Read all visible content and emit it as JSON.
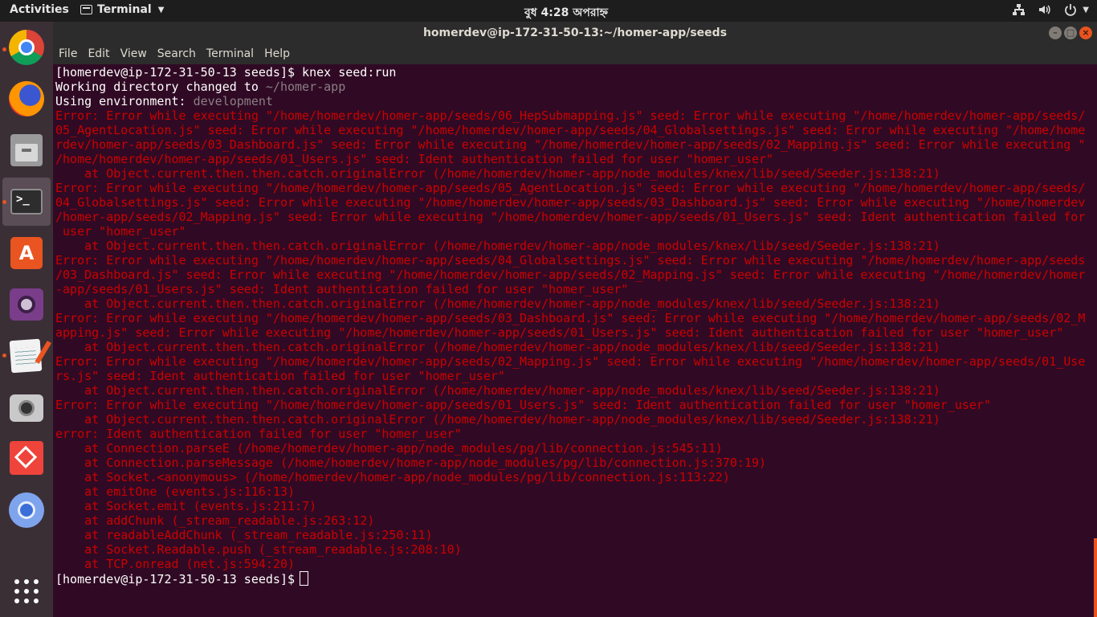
{
  "topbar": {
    "activities": "Activities",
    "app_name": "Terminal",
    "clock": "বুধ  4:28 অপরাহ্ন"
  },
  "window": {
    "title": "homerdev@ip-172-31-50-13:~/homer-app/seeds",
    "buttons": {
      "minimize": "–",
      "maximize": "□",
      "close": "×"
    }
  },
  "menu": [
    "File",
    "Edit",
    "View",
    "Search",
    "Terminal",
    "Help"
  ],
  "dock": [
    {
      "name": "chrome-icon",
      "running": true
    },
    {
      "name": "firefox-icon",
      "running": false
    },
    {
      "name": "files-icon",
      "running": false
    },
    {
      "name": "terminal-icon",
      "running": true,
      "active": true
    },
    {
      "name": "software-center-icon",
      "running": false
    },
    {
      "name": "cheese-webcam-icon",
      "running": false
    },
    {
      "name": "text-editor-icon",
      "running": true
    },
    {
      "name": "screenshot-camera-icon",
      "running": false
    },
    {
      "name": "anydesk-icon",
      "running": false
    },
    {
      "name": "chromium-icon",
      "running": false
    }
  ],
  "terminal": {
    "prompt": "[homerdev@ip-172-31-50-13 seeds]$",
    "command": "knex seed:run",
    "lines": [
      {
        "t": "Working directory changed to ",
        "v": "~/homer-app"
      },
      {
        "t": "Using environment: ",
        "v": "development"
      },
      {
        "red": "Error: Error while executing \"/home/homerdev/homer-app/seeds/06_HepSubmapping.js\" seed: Error while executing \"/home/homerdev/homer-app/seeds/"
      },
      {
        "red": "05_AgentLocation.js\" seed: Error while executing \"/home/homerdev/homer-app/seeds/04_Globalsettings.js\" seed: Error while executing \"/home/home"
      },
      {
        "red": "rdev/homer-app/seeds/03_Dashboard.js\" seed: Error while executing \"/home/homerdev/homer-app/seeds/02_Mapping.js\" seed: Error while executing \""
      },
      {
        "red": "/home/homerdev/homer-app/seeds/01_Users.js\" seed: Ident authentication failed for user \"homer_user\""
      },
      {
        "red": "    at Object.current.then.then.catch.originalError (/home/homerdev/homer-app/node_modules/knex/lib/seed/Seeder.js:138:21)"
      },
      {
        "red": "Error: Error while executing \"/home/homerdev/homer-app/seeds/05_AgentLocation.js\" seed: Error while executing \"/home/homerdev/homer-app/seeds/"
      },
      {
        "red": "04_Globalsettings.js\" seed: Error while executing \"/home/homerdev/homer-app/seeds/03_Dashboard.js\" seed: Error while executing \"/home/homerdev"
      },
      {
        "red": "/homer-app/seeds/02_Mapping.js\" seed: Error while executing \"/home/homerdev/homer-app/seeds/01_Users.js\" seed: Ident authentication failed for"
      },
      {
        "red": " user \"homer_user\""
      },
      {
        "red": "    at Object.current.then.then.catch.originalError (/home/homerdev/homer-app/node_modules/knex/lib/seed/Seeder.js:138:21)"
      },
      {
        "red": "Error: Error while executing \"/home/homerdev/homer-app/seeds/04_Globalsettings.js\" seed: Error while executing \"/home/homerdev/homer-app/seeds"
      },
      {
        "red": "/03_Dashboard.js\" seed: Error while executing \"/home/homerdev/homer-app/seeds/02_Mapping.js\" seed: Error while executing \"/home/homerdev/homer"
      },
      {
        "red": "-app/seeds/01_Users.js\" seed: Ident authentication failed for user \"homer_user\""
      },
      {
        "red": "    at Object.current.then.then.catch.originalError (/home/homerdev/homer-app/node_modules/knex/lib/seed/Seeder.js:138:21)"
      },
      {
        "red": "Error: Error while executing \"/home/homerdev/homer-app/seeds/03_Dashboard.js\" seed: Error while executing \"/home/homerdev/homer-app/seeds/02_M"
      },
      {
        "red": "apping.js\" seed: Error while executing \"/home/homerdev/homer-app/seeds/01_Users.js\" seed: Ident authentication failed for user \"homer_user\""
      },
      {
        "red": "    at Object.current.then.then.catch.originalError (/home/homerdev/homer-app/node_modules/knex/lib/seed/Seeder.js:138:21)"
      },
      {
        "red": "Error: Error while executing \"/home/homerdev/homer-app/seeds/02_Mapping.js\" seed: Error while executing \"/home/homerdev/homer-app/seeds/01_Use"
      },
      {
        "red": "rs.js\" seed: Ident authentication failed for user \"homer_user\""
      },
      {
        "red": "    at Object.current.then.then.catch.originalError (/home/homerdev/homer-app/node_modules/knex/lib/seed/Seeder.js:138:21)"
      },
      {
        "red": "Error: Error while executing \"/home/homerdev/homer-app/seeds/01_Users.js\" seed: Ident authentication failed for user \"homer_user\""
      },
      {
        "red": "    at Object.current.then.then.catch.originalError (/home/homerdev/homer-app/node_modules/knex/lib/seed/Seeder.js:138:21)"
      },
      {
        "red": "error: Ident authentication failed for user \"homer_user\""
      },
      {
        "red": "    at Connection.parseE (/home/homerdev/homer-app/node_modules/pg/lib/connection.js:545:11)"
      },
      {
        "red": "    at Connection.parseMessage (/home/homerdev/homer-app/node_modules/pg/lib/connection.js:370:19)"
      },
      {
        "red": "    at Socket.<anonymous> (/home/homerdev/homer-app/node_modules/pg/lib/connection.js:113:22)"
      },
      {
        "red": "    at emitOne (events.js:116:13)"
      },
      {
        "red": "    at Socket.emit (events.js:211:7)"
      },
      {
        "red": "    at addChunk (_stream_readable.js:263:12)"
      },
      {
        "red": "    at readableAddChunk (_stream_readable.js:250:11)"
      },
      {
        "red": "    at Socket.Readable.push (_stream_readable.js:208:10)"
      },
      {
        "red": "    at TCP.onread (net.js:594:20)"
      }
    ],
    "final_prompt": "[homerdev@ip-172-31-50-13 seeds]$"
  },
  "colors": {
    "terminal_bg": "#300a24",
    "error_red": "#cc0000",
    "accent": "#e95420"
  }
}
